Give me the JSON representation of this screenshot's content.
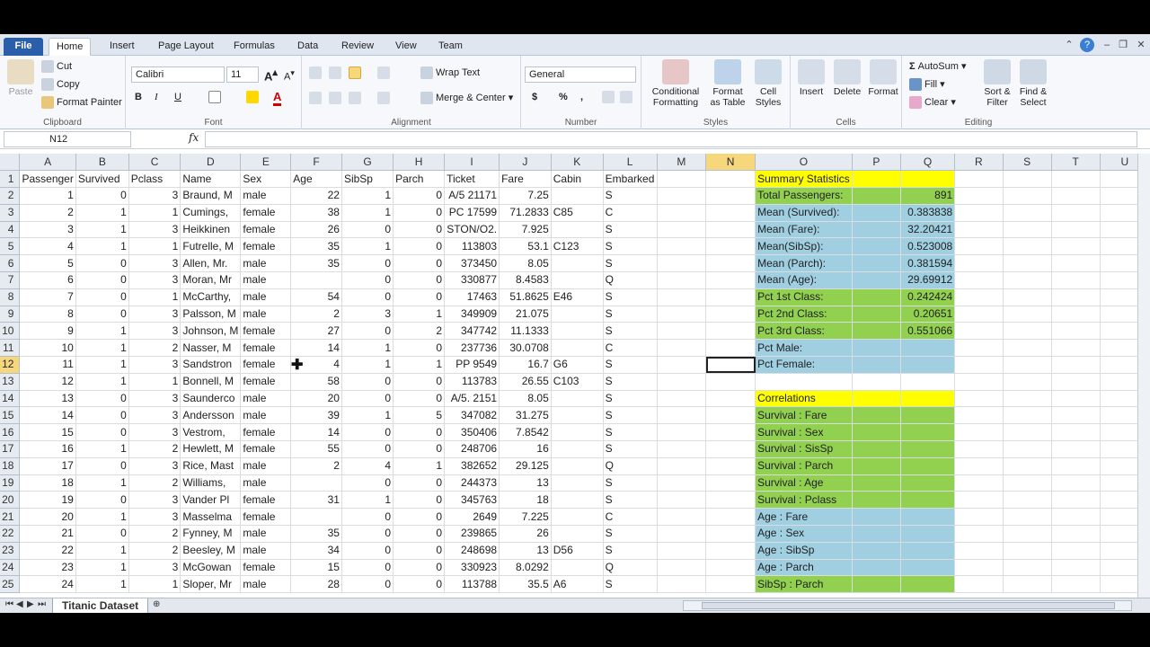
{
  "ribbon": {
    "tabs": [
      "File",
      "Home",
      "Insert",
      "Page Layout",
      "Formulas",
      "Data",
      "Review",
      "View",
      "Team"
    ],
    "clipboard": {
      "paste": "Paste",
      "cut": "Cut",
      "copy": "Copy",
      "format_painter": "Format Painter",
      "label": "Clipboard"
    },
    "font": {
      "name": "Calibri",
      "size": "11",
      "bold": "B",
      "italic": "I",
      "underline": "U",
      "label": "Font"
    },
    "alignment": {
      "wrap": "Wrap Text",
      "merge": "Merge & Center",
      "label": "Alignment"
    },
    "number": {
      "format": "General",
      "currency": "$",
      "percent": "%",
      "comma": ",",
      "label": "Number"
    },
    "styles": {
      "conditional": "Conditional Formatting",
      "format_table": "Format as Table",
      "cell_styles": "Cell Styles",
      "label": "Styles"
    },
    "cells": {
      "insert": "Insert",
      "delete": "Delete",
      "format": "Format",
      "label": "Cells"
    },
    "editing": {
      "autosum": "AutoSum",
      "fill": "Fill",
      "clear": "Clear",
      "sort": "Sort & Filter",
      "find": "Find & Select",
      "label": "Editing"
    }
  },
  "formula_bar": {
    "name_box": "N12",
    "fx": "fx",
    "value": ""
  },
  "columns": [
    "A",
    "B",
    "C",
    "D",
    "E",
    "F",
    "G",
    "H",
    "I",
    "J",
    "K",
    "L",
    "M",
    "N",
    "O",
    "P",
    "Q",
    "R",
    "S",
    "T",
    "U"
  ],
  "selected_col": "N",
  "selected_row": "12",
  "rows": [
    [
      "1",
      "Passenger",
      "Survived",
      "Pclass",
      "Name",
      "Sex",
      "Age",
      "SibSp",
      "Parch",
      "Ticket",
      "Fare",
      "Cabin",
      "Embarked",
      "",
      "",
      "Summary Statistics",
      "",
      "",
      "",
      "",
      "",
      ""
    ],
    [
      "2",
      "1",
      "0",
      "3",
      "Braund, M",
      "male",
      "22",
      "1",
      "0",
      "A/5 21171",
      "7.25",
      "",
      "S",
      "",
      "",
      "Total Passengers:",
      "",
      "891",
      "",
      "",
      "",
      ""
    ],
    [
      "3",
      "2",
      "1",
      "1",
      "Cumings,",
      "female",
      "38",
      "1",
      "0",
      "PC 17599",
      "71.2833",
      "C85",
      "C",
      "",
      "",
      "Mean (Survived):",
      "",
      "0.383838",
      "",
      "",
      "",
      ""
    ],
    [
      "4",
      "3",
      "1",
      "3",
      "Heikkinen",
      "female",
      "26",
      "0",
      "0",
      "STON/O2.",
      "7.925",
      "",
      "S",
      "",
      "",
      "Mean (Fare):",
      "",
      "32.20421",
      "",
      "",
      "",
      ""
    ],
    [
      "5",
      "4",
      "1",
      "1",
      "Futrelle, M",
      "female",
      "35",
      "1",
      "0",
      "113803",
      "53.1",
      "C123",
      "S",
      "",
      "",
      "Mean(SibSp):",
      "",
      "0.523008",
      "",
      "",
      "",
      ""
    ],
    [
      "6",
      "5",
      "0",
      "3",
      "Allen, Mr.",
      "male",
      "35",
      "0",
      "0",
      "373450",
      "8.05",
      "",
      "S",
      "",
      "",
      "Mean (Parch):",
      "",
      "0.381594",
      "",
      "",
      "",
      ""
    ],
    [
      "7",
      "6",
      "0",
      "3",
      "Moran, Mr",
      "male",
      "",
      "0",
      "0",
      "330877",
      "8.4583",
      "",
      "Q",
      "",
      "",
      "Mean (Age):",
      "",
      "29.69912",
      "",
      "",
      "",
      ""
    ],
    [
      "8",
      "7",
      "0",
      "1",
      "McCarthy,",
      "male",
      "54",
      "0",
      "0",
      "17463",
      "51.8625",
      "E46",
      "S",
      "",
      "",
      "Pct 1st Class:",
      "",
      "0.242424",
      "",
      "",
      "",
      ""
    ],
    [
      "9",
      "8",
      "0",
      "3",
      "Palsson, M",
      "male",
      "2",
      "3",
      "1",
      "349909",
      "21.075",
      "",
      "S",
      "",
      "",
      "Pct 2nd Class:",
      "",
      "0.20651",
      "",
      "",
      "",
      ""
    ],
    [
      "10",
      "9",
      "1",
      "3",
      "Johnson, M",
      "female",
      "27",
      "0",
      "2",
      "347742",
      "11.1333",
      "",
      "S",
      "",
      "",
      "Pct 3rd Class:",
      "",
      "0.551066",
      "",
      "",
      "",
      ""
    ],
    [
      "11",
      "10",
      "1",
      "2",
      "Nasser, M",
      "female",
      "14",
      "1",
      "0",
      "237736",
      "30.0708",
      "",
      "C",
      "",
      "",
      "Pct Male:",
      "",
      "",
      "",
      "",
      "",
      ""
    ],
    [
      "12",
      "11",
      "1",
      "3",
      "Sandstron",
      "female",
      "4",
      "1",
      "1",
      "PP 9549",
      "16.7",
      "G6",
      "S",
      "",
      "",
      "Pct Female:",
      "",
      "",
      "",
      "",
      "",
      ""
    ],
    [
      "13",
      "12",
      "1",
      "1",
      "Bonnell, M",
      "female",
      "58",
      "0",
      "0",
      "113783",
      "26.55",
      "C103",
      "S",
      "",
      "",
      "",
      "",
      "",
      "",
      "",
      "",
      ""
    ],
    [
      "14",
      "13",
      "0",
      "3",
      "Saunderco",
      "male",
      "20",
      "0",
      "0",
      "A/5. 2151",
      "8.05",
      "",
      "S",
      "",
      "",
      "Correlations",
      "",
      "",
      "",
      "",
      "",
      ""
    ],
    [
      "15",
      "14",
      "0",
      "3",
      "Andersson",
      "male",
      "39",
      "1",
      "5",
      "347082",
      "31.275",
      "",
      "S",
      "",
      "",
      "Survival : Fare",
      "",
      "",
      "",
      "",
      "",
      ""
    ],
    [
      "16",
      "15",
      "0",
      "3",
      "Vestrom,",
      "female",
      "14",
      "0",
      "0",
      "350406",
      "7.8542",
      "",
      "S",
      "",
      "",
      "Survival : Sex",
      "",
      "",
      "",
      "",
      "",
      ""
    ],
    [
      "17",
      "16",
      "1",
      "2",
      "Hewlett, M",
      "female",
      "55",
      "0",
      "0",
      "248706",
      "16",
      "",
      "S",
      "",
      "",
      "Survival : SisSp",
      "",
      "",
      "",
      "",
      "",
      ""
    ],
    [
      "18",
      "17",
      "0",
      "3",
      "Rice, Mast",
      "male",
      "2",
      "4",
      "1",
      "382652",
      "29.125",
      "",
      "Q",
      "",
      "",
      "Survival : Parch",
      "",
      "",
      "",
      "",
      "",
      ""
    ],
    [
      "19",
      "18",
      "1",
      "2",
      "Williams,",
      "male",
      "",
      "0",
      "0",
      "244373",
      "13",
      "",
      "S",
      "",
      "",
      "Survival : Age",
      "",
      "",
      "",
      "",
      "",
      ""
    ],
    [
      "20",
      "19",
      "0",
      "3",
      "Vander Pl",
      "female",
      "31",
      "1",
      "0",
      "345763",
      "18",
      "",
      "S",
      "",
      "",
      "Survival : Pclass",
      "",
      "",
      "",
      "",
      "",
      ""
    ],
    [
      "21",
      "20",
      "1",
      "3",
      "Masselma",
      "female",
      "",
      "0",
      "0",
      "2649",
      "7.225",
      "",
      "C",
      "",
      "",
      "Age : Fare",
      "",
      "",
      "",
      "",
      "",
      ""
    ],
    [
      "22",
      "21",
      "0",
      "2",
      "Fynney, M",
      "male",
      "35",
      "0",
      "0",
      "239865",
      "26",
      "",
      "S",
      "",
      "",
      "Age : Sex",
      "",
      "",
      "",
      "",
      "",
      ""
    ],
    [
      "23",
      "22",
      "1",
      "2",
      "Beesley, M",
      "male",
      "34",
      "0",
      "0",
      "248698",
      "13",
      "D56",
      "S",
      "",
      "",
      "Age : SibSp",
      "",
      "",
      "",
      "",
      "",
      ""
    ],
    [
      "24",
      "23",
      "1",
      "3",
      "McGowan",
      "female",
      "15",
      "0",
      "0",
      "330923",
      "8.0292",
      "",
      "Q",
      "",
      "",
      "Age : Parch",
      "",
      "",
      "",
      "",
      "",
      ""
    ],
    [
      "25",
      "24",
      "1",
      "1",
      "Sloper, Mr",
      "male",
      "28",
      "0",
      "0",
      "113788",
      "35.5",
      "A6",
      "S",
      "",
      "",
      "SibSp : Parch",
      "",
      "",
      "",
      "",
      "",
      ""
    ]
  ],
  "sheet_tab": "Titanic Dataset",
  "colors": {
    "yellow": "#ffff00",
    "green": "#92d050",
    "blue": "#9fcfe0"
  }
}
